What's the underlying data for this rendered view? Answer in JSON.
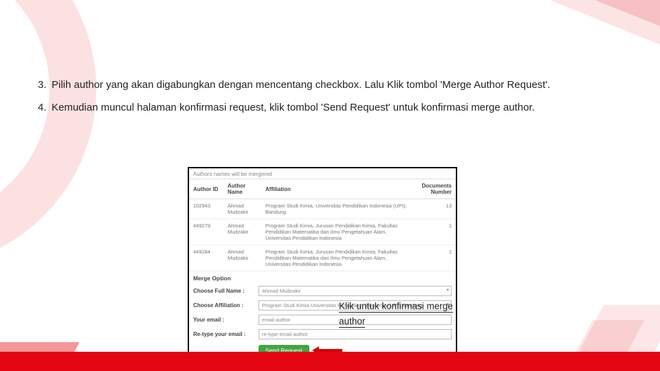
{
  "steps": {
    "s3_num": "3.",
    "s3_text": "Pilih author yang akan digabungkan dengan mencentang checkbox. Lalu Klik tombol 'Merge Author Request'.",
    "s4_num": "4.",
    "s4_text": "Kemudian muncul halaman konfirmasi request, klik tombol 'Send Request' untuk konfirmasi merge author."
  },
  "screen": {
    "caption": "Authors names will be mergered",
    "headers": {
      "id": "Author ID",
      "name": "Author Name",
      "aff": "Affiliation",
      "doc": "Documents Number"
    },
    "rows": [
      {
        "id": "102943",
        "name": "Ahmad Mudzakir",
        "aff": "Program Studi Kimia, Universitas Pendidikan Indonesia (UPI), Bandung",
        "doc": "13"
      },
      {
        "id": "449279",
        "name": "Ahmad Mudzakir",
        "aff": "Program Studi Kimia, Jurusan Pendidikan Kimia, Fakultas Pendidikan Matematika dan Ilmu Pengetahuan Alam, Universitas Pendidikan Indonesia",
        "doc": "1"
      },
      {
        "id": "449284",
        "name": "Ahmad Mudzakir",
        "aff": "Program Studi Kimia, Jurusan Pendidikan Kimia, Fakultas Pendidikan Matematika dan Ilmu Pengetahuan Alam, Universitas Pendidikan Indonesia",
        "doc": "1"
      }
    ],
    "merge_option": "Merge Option",
    "form": {
      "fullname_lbl": "Choose Full Name :",
      "fullname_val": "Ahmad Mudzakir",
      "aff_lbl": "Choose Affiliation :",
      "aff_val": "Program Studi Kimia Universitas Pendidikan Indonesia (UPI) Bandung",
      "email_lbl": "Your email :",
      "email_val": "email author",
      "reemail_lbl": "Re-type your email :",
      "reemail_val": "re-type email author"
    },
    "button": "Send Request"
  },
  "callout": {
    "line1": "Klik untuk konfirmasi merge",
    "line2": "author"
  }
}
